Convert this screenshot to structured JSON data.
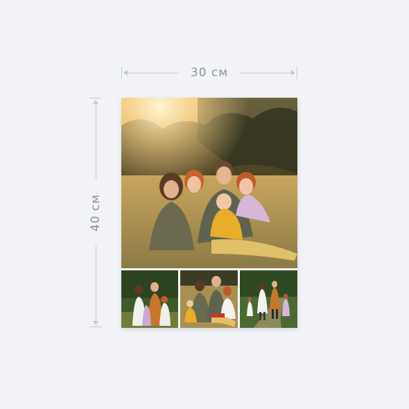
{
  "dimensions": {
    "width_label": "30 см",
    "height_label": "40 см"
  },
  "colors": {
    "background": "#f2f3f7",
    "dimension_line": "#c7cad3",
    "dimension_text": "#8e939c",
    "canvas": "#ffffff"
  },
  "photos": [
    {
      "name": "main-family-photo",
      "scene": "family-sitting-in-sunset-meadow"
    },
    {
      "name": "small-photo-1",
      "scene": "family-standing-in-forest"
    },
    {
      "name": "small-photo-2",
      "scene": "family-sitting-in-field"
    },
    {
      "name": "small-photo-3",
      "scene": "family-walking-on-path"
    }
  ]
}
